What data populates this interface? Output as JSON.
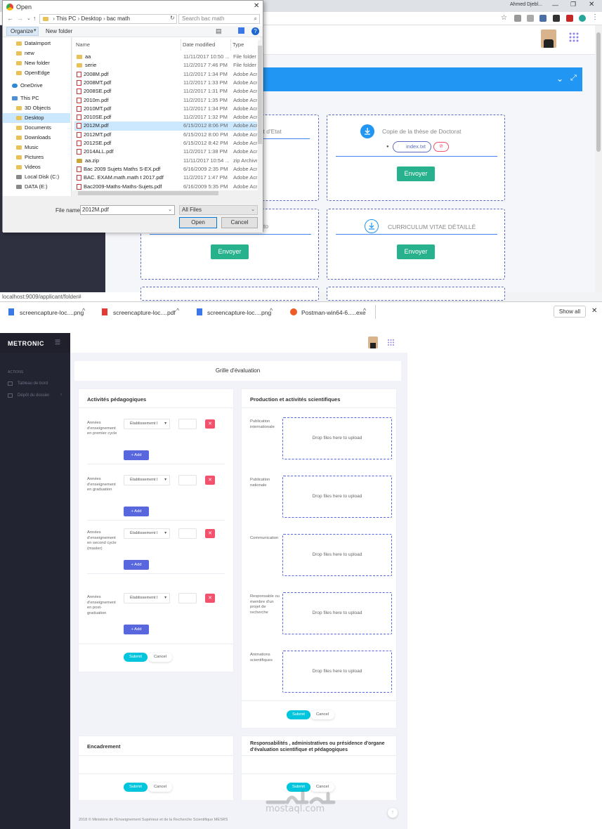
{
  "browser": {
    "profile_name": "Ahmed Djebl...",
    "status_url": "localhost:9009/applicant/folder#",
    "downloads": [
      "screencapture-loc....png",
      "screencapture-loc....pdf",
      "screencapture-loc....png",
      "Postman-win64-6.....exe"
    ],
    "show_all": "Show all"
  },
  "dialog": {
    "title": "Open",
    "breadcrumb": [
      "This PC",
      "Desktop",
      "bac math"
    ],
    "search_placeholder": "Search bac math",
    "organize": "Organize",
    "new_folder": "New folder",
    "nav_items": [
      {
        "label": "DataImport",
        "type": "folder"
      },
      {
        "label": "new",
        "type": "folder"
      },
      {
        "label": "New folder",
        "type": "folder"
      },
      {
        "label": "OpenEdge",
        "type": "folder"
      },
      {
        "label": "OneDrive",
        "type": "cloud"
      },
      {
        "label": "This PC",
        "type": "pc"
      },
      {
        "label": "3D Objects",
        "type": "folder"
      },
      {
        "label": "Desktop",
        "type": "folder"
      },
      {
        "label": "Documents",
        "type": "folder"
      },
      {
        "label": "Downloads",
        "type": "folder"
      },
      {
        "label": "Music",
        "type": "folder"
      },
      {
        "label": "Pictures",
        "type": "folder"
      },
      {
        "label": "Videos",
        "type": "folder"
      },
      {
        "label": "Local Disk (C:)",
        "type": "disk"
      },
      {
        "label": "DATA (E:)",
        "type": "disk"
      }
    ],
    "columns": [
      "Name",
      "Date modified",
      "Type"
    ],
    "files": [
      {
        "name": "aa",
        "date": "11/11/2017 10:50 ...",
        "type": "File folder",
        "icon": "folder"
      },
      {
        "name": "serie",
        "date": "11/2/2017 7:46 PM",
        "type": "File folder",
        "icon": "folder"
      },
      {
        "name": "2008M.pdf",
        "date": "11/2/2017 1:34 PM",
        "type": "Adobe Acro",
        "icon": "pdf"
      },
      {
        "name": "2008MT.pdf",
        "date": "11/2/2017 1:33 PM",
        "type": "Adobe Acro",
        "icon": "pdf"
      },
      {
        "name": "2008SE.pdf",
        "date": "11/2/2017 1:31 PM",
        "type": "Adobe Acro",
        "icon": "pdf"
      },
      {
        "name": "2010m.pdf",
        "date": "11/2/2017 1:35 PM",
        "type": "Adobe Acro",
        "icon": "pdf"
      },
      {
        "name": "2010MT.pdf",
        "date": "11/2/2017 1:34 PM",
        "type": "Adobe Acro",
        "icon": "pdf"
      },
      {
        "name": "2010SE.pdf",
        "date": "11/2/2017 1:32 PM",
        "type": "Adobe Acro",
        "icon": "pdf"
      },
      {
        "name": "2012M.pdf",
        "date": "6/15/2012 8:06 PM",
        "type": "Adobe Acro",
        "icon": "pdf",
        "selected": true
      },
      {
        "name": "2012MT.pdf",
        "date": "6/15/2012 8:00 PM",
        "type": "Adobe Acro",
        "icon": "pdf"
      },
      {
        "name": "2012SE.pdf",
        "date": "6/15/2012 8:42 PM",
        "type": "Adobe Acro",
        "icon": "pdf"
      },
      {
        "name": "2014ALL.pdf",
        "date": "11/2/2017 1:38 PM",
        "type": "Adobe Acro",
        "icon": "pdf"
      },
      {
        "name": "aa.zip",
        "date": "11/11/2017 10:54 ...",
        "type": "zip Archive",
        "icon": "zip"
      },
      {
        "name": "Bac 2009 Sujets Maths S-EX.pdf",
        "date": "6/16/2009 2:35 PM",
        "type": "Adobe Acro",
        "icon": "pdf"
      },
      {
        "name": "BAC. EXAM.math.math t 2017.pdf",
        "date": "11/2/2017 1:47 PM",
        "type": "Adobe Acro",
        "icon": "pdf"
      },
      {
        "name": "Bac2009-Maths-Maths-Sujets.pdf",
        "date": "6/16/2009 5:35 PM",
        "type": "Adobe Acro",
        "icon": "pdf"
      }
    ],
    "file_name_label": "File name:",
    "file_name_value": "2012M.pdf",
    "filter_value": "All Files",
    "open_label": "Open",
    "cancel_label": "Cancel"
  },
  "app1": {
    "card1_title": "rat d'Etat",
    "card2_title": "Copie de la thèse de Doctorat",
    "attachment": "index.txt",
    "card3_title": "to",
    "card4_title": "CURRICULUM VITAE DÉTAILLÉ",
    "send_label": "Envoyer"
  },
  "app2": {
    "brand": "METRONIC",
    "sidebar_section": "ACTIONS",
    "sidebar_items": [
      "Tableau de bord",
      "Dépôt du dossier"
    ],
    "page_title": "Grille d'évaluation",
    "panel_activities": {
      "title": "Activités pédagogiques",
      "rows": [
        {
          "label": "Années d'enseignement en premier cycle",
          "select": "Établissement I"
        },
        {
          "label": "Années d'enseignement en graduation",
          "select": "Établissement I"
        },
        {
          "label": "Années d'enseignement en second cycle (master)",
          "select": "Établissement I"
        },
        {
          "label": "Années d'enseignement en post-graduation",
          "select": "Établissement I"
        }
      ],
      "add_label": "Add"
    },
    "panel_production": {
      "title": "Production et activités scientifiques",
      "rows": [
        {
          "label": "Publication internationale",
          "drop": "Drop files here to upload"
        },
        {
          "label": "Publication nationale",
          "drop": "Drop files here to upload"
        },
        {
          "label": "Communication",
          "drop": "Drop files here to upload"
        },
        {
          "label": "Responsable ou membre d'un projet de recherche",
          "drop": "Drop files here to upload"
        },
        {
          "label": "Animations scientifiques",
          "drop": "Drop files here to upload"
        }
      ]
    },
    "panel_encadrement": {
      "title": "Encadrement"
    },
    "panel_responsabilites": {
      "title": "Responsabilités , administratives ou présidence d'organe d'évaluation scientifique et pédagogiques"
    },
    "submit_label": "Submit",
    "cancel_label": "Cancel",
    "footer": "2018 © Ministère de l'Enseignement Supérieur et de la Recherche Scientifique MESRS",
    "watermark_latin": "mostaql.com"
  },
  "colors": {
    "primary_blue": "#2196f3",
    "envoyer_green": "#27b18c",
    "metronic_dark": "#232432",
    "add_blue": "#5867dd",
    "submit_cyan": "#00c5dc",
    "danger": "#f4516c"
  }
}
